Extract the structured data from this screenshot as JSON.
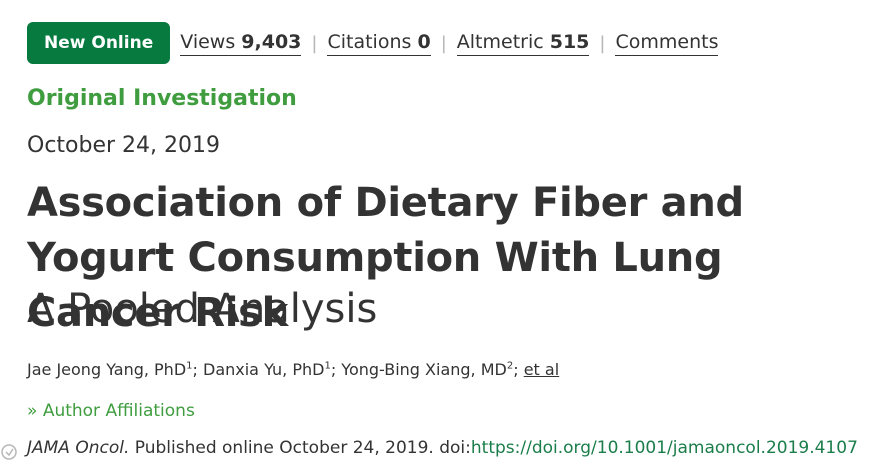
{
  "topbar": {
    "badge": "New Online",
    "views_label": "Views",
    "views_value": "9,403",
    "citations_label": "Citations",
    "citations_value": "0",
    "altmetric_label": "Altmetric",
    "altmetric_value": "515",
    "comments_label": "Comments",
    "separator": "|"
  },
  "article": {
    "section": "Original Investigation",
    "date": "October 24, 2019",
    "title": "Association of Dietary Fiber and Yogurt Consumption With Lung Cancer Risk",
    "subtitle": "A Pooled Analysis",
    "authors": [
      {
        "name": "Jae Jeong Yang, PhD",
        "sup": "1",
        "sep": "; "
      },
      {
        "name": "Danxia Yu, PhD",
        "sup": "1",
        "sep": "; "
      },
      {
        "name": "Yong-Bing Xiang, MD",
        "sup": "2",
        "sep": "; "
      }
    ],
    "etal": "et al",
    "affiliations_icon": "»",
    "affiliations_label": "Author Affiliations",
    "journal": "JAMA Oncol.",
    "published_text": " Published online October 24, 2019. doi:",
    "doi": "https://doi.org/10.1001/jamaoncol.2019.4107"
  },
  "colors": {
    "badge_bg": "#067a3f",
    "section_green": "#3f9d3f",
    "doi_link": "#1a7d4a"
  }
}
